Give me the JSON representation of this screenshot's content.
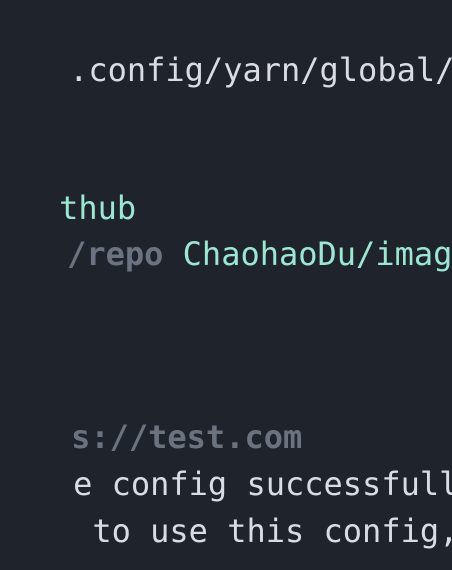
{
  "terminal": {
    "lines": {
      "config_path": ".config/yarn/global/n",
      "github": "thub",
      "repo_flag": "/repo",
      "repo_value": " ChaohaoDu/image",
      "url": "s://test.com",
      "success": "e config successfully",
      "usage": " to use this config,"
    }
  }
}
